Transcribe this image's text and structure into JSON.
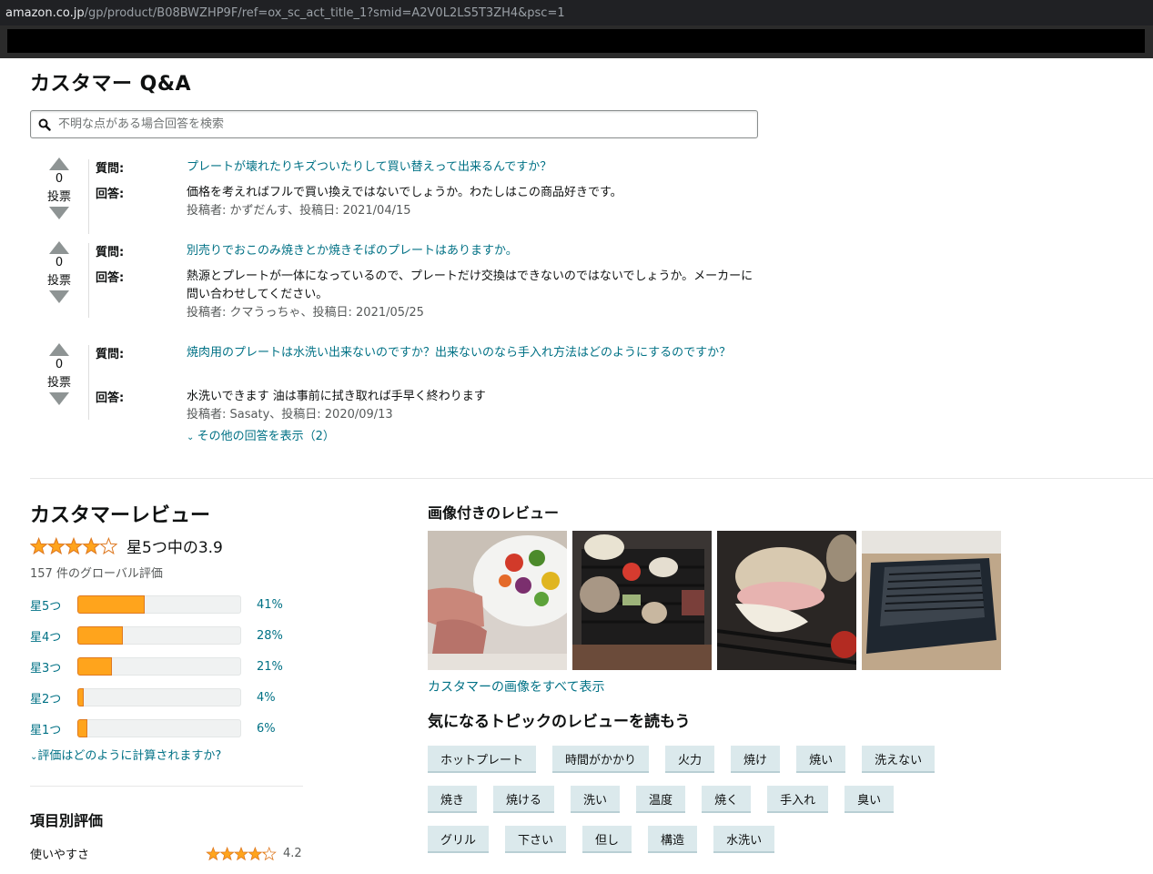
{
  "browser": {
    "url_host": "amazon.co.jp",
    "url_path": "/gp/product/B08BWZHP9F/ref=ox_sc_act_title_1?smid=A2V0L2LS5T3ZH4&psc=1"
  },
  "qa": {
    "title": "カスタマー Q&A",
    "search_placeholder": "不明な点がある場合回答を検索",
    "question_label": "質問:",
    "answer_label": "回答:",
    "vote_label": "投票",
    "items": [
      {
        "votes": "0",
        "question": "プレートが壊れたりキズついたりして買い替えって出来るんですか？",
        "answer": "価格を考えればフルで買い換えではないでしょうか。わたしはこの商品好きです。",
        "meta": "投稿者: かずだんす、投稿日: 2021/04/15"
      },
      {
        "votes": "0",
        "question": "別売りでおこのみ焼きとか焼きそばのプレートはありますか。",
        "answer": "熱源とプレートが一体になっているので、プレートだけ交換はできないのではないでしょうか。メーカーに問い合わせしてください。",
        "meta": "投稿者: クマうっちゃ、投稿日: 2021/05/25"
      },
      {
        "votes": "0",
        "question": "焼肉用のプレートは水洗い出来ないのですか？出来ないのなら手入れ方法はどのようにするのですか？",
        "answer": "水洗いできます 油は事前に拭き取れば手早く終わります",
        "meta": "投稿者: Sasaty、投稿日: 2020/09/13",
        "more": "その他の回答を表示（2）"
      }
    ]
  },
  "reviews": {
    "title": "カスタマーレビュー",
    "rating_value": 3.9,
    "rating_text": "星5つ中の3.9",
    "global_count": "157 件のグローバル評価",
    "histogram": [
      {
        "label": "星5つ",
        "percent": 41,
        "percent_text": "41%"
      },
      {
        "label": "星4つ",
        "percent": 28,
        "percent_text": "28%"
      },
      {
        "label": "星3つ",
        "percent": 21,
        "percent_text": "21%"
      },
      {
        "label": "星2つ",
        "percent": 4,
        "percent_text": "4%"
      },
      {
        "label": "星1つ",
        "percent": 6,
        "percent_text": "6%"
      }
    ],
    "how_calculated": "評価はどのように計算されますか?",
    "attributes_title": "項目別評価",
    "attributes": [
      {
        "name": "使いやすさ",
        "value": 4.2,
        "value_text": "4.2"
      }
    ],
    "images_title": "画像付きのレビュー",
    "see_all_images": "カスタマーの画像をすべて表示",
    "topics_title": "気になるトピックのレビューを読もう",
    "topics": [
      [
        "ホットプレート",
        "時間がかかり",
        "火力",
        "焼け",
        "焼い",
        "洗えない"
      ],
      [
        "焼き",
        "焼ける",
        "洗い",
        "温度",
        "焼く",
        "手入れ",
        "臭い"
      ],
      [
        "グリル",
        "下さい",
        "但し",
        "構造",
        "水洗い"
      ]
    ]
  },
  "colors": {
    "link": "#007185",
    "star": "#ffa41c",
    "chip_bg": "#dbe9ec"
  }
}
